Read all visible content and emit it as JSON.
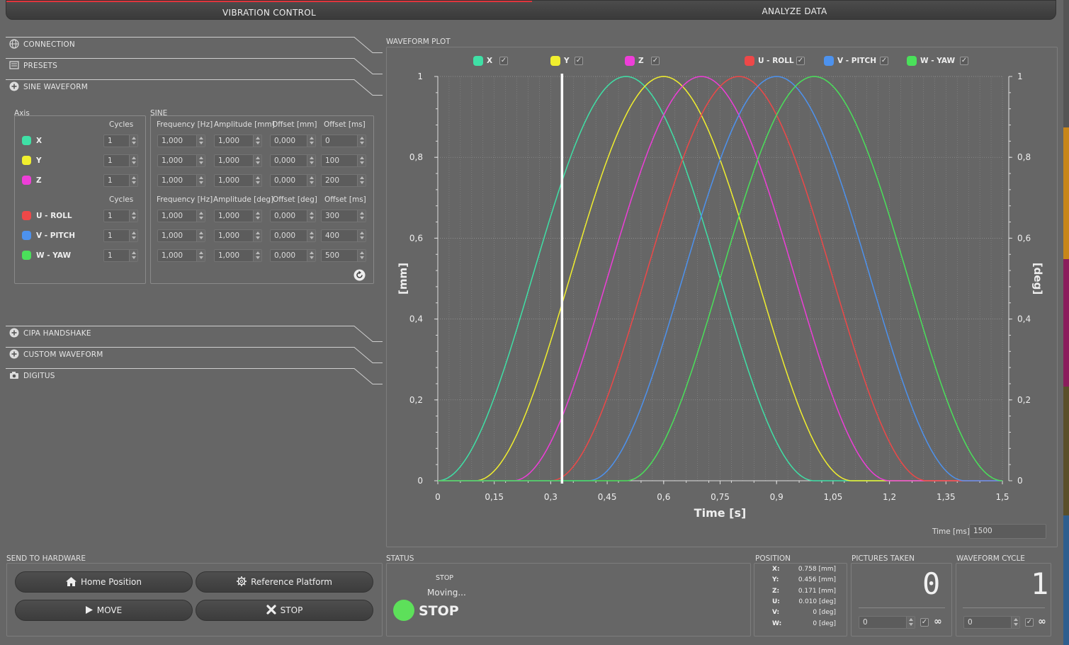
{
  "tabs": {
    "vibration": "VIBRATION CONTROL",
    "analyze": "ANALYZE DATA"
  },
  "sections": {
    "connection": "CONNECTION",
    "presets": "PRESETS",
    "sine_waveform": "SINE WAVEFORM",
    "cipa": "CIPA HANDSHAKE",
    "custom": "CUSTOM WAVEFORM",
    "digitus": "DIGITUS"
  },
  "axis_group": {
    "title": "Axis",
    "cycles_header": "Cycles"
  },
  "sine_group": {
    "title": "SINE",
    "lin_headers": [
      "Frequency [Hz]",
      "Amplitude [mm]",
      "Offset [mm]",
      "Offset [ms]"
    ],
    "rot_headers": [
      "Frequency [Hz]",
      "Amplitude [deg]",
      "Offset [deg]",
      "Offset [ms]"
    ]
  },
  "axes": [
    {
      "name": "X",
      "color": "#3fe0a6",
      "cycles": "1",
      "freq": "1,000",
      "amp": "1,000",
      "off": "0,000",
      "offms": "0"
    },
    {
      "name": "Y",
      "color": "#f1ef2e",
      "cycles": "1",
      "freq": "1,000",
      "amp": "1,000",
      "off": "0,000",
      "offms": "100"
    },
    {
      "name": "Z",
      "color": "#ee3ed8",
      "cycles": "1",
      "freq": "1,000",
      "amp": "1,000",
      "off": "0,000",
      "offms": "200"
    },
    {
      "name": "U - ROLL",
      "color": "#ee4848",
      "cycles": "1",
      "freq": "1,000",
      "amp": "1,000",
      "off": "0,000",
      "offms": "300"
    },
    {
      "name": "V - PITCH",
      "color": "#4d92ee",
      "cycles": "1",
      "freq": "1,000",
      "amp": "1,000",
      "off": "0,000",
      "offms": "400"
    },
    {
      "name": "W - YAW",
      "color": "#4ae05a",
      "cycles": "1",
      "freq": "1,000",
      "amp": "1,000",
      "off": "0,000",
      "offms": "500"
    }
  ],
  "plot": {
    "title": "WAVEFORM PLOT",
    "time_label": "Time [ms]",
    "time_value": "1500",
    "check": "✓"
  },
  "chart_data": {
    "type": "line",
    "xlabel": "Time [s]",
    "ylabel": "[mm]",
    "y2label": "[deg]",
    "xlim": [
      0,
      1.5
    ],
    "ylim": [
      0,
      1
    ],
    "x_ticks": [
      "0",
      "0,15",
      "0,3",
      "0,45",
      "0,6",
      "0,75",
      "0,9",
      "1,05",
      "1,2",
      "1,35",
      "1,5"
    ],
    "y_ticks": [
      "0",
      "0,2",
      "0,4",
      "0,6",
      "0,8",
      "1"
    ],
    "grid": true,
    "legend_position": "top",
    "cursor_x": 0.33,
    "series": [
      {
        "name": "X",
        "color": "#3fe0a6",
        "x": [
          0,
          0.1,
          0.2,
          0.3,
          0.4,
          0.5,
          0.6,
          0.7,
          0.8,
          0.9,
          1.0,
          1.1,
          1.2,
          1.3,
          1.4,
          1.5
        ],
        "values": [
          0,
          0.095,
          0.345,
          0.655,
          0.905,
          1,
          0.905,
          0.655,
          0.345,
          0.095,
          0,
          0,
          0,
          0,
          0,
          0
        ]
      },
      {
        "name": "Y",
        "color": "#f1ef2e",
        "x": [
          0,
          0.1,
          0.2,
          0.3,
          0.4,
          0.5,
          0.6,
          0.7,
          0.8,
          0.9,
          1.0,
          1.1,
          1.2,
          1.3,
          1.4,
          1.5
        ],
        "values": [
          0,
          0,
          0.095,
          0.345,
          0.655,
          0.905,
          1,
          0.905,
          0.655,
          0.345,
          0.095,
          0,
          0,
          0,
          0,
          0
        ]
      },
      {
        "name": "Z",
        "color": "#ee3ed8",
        "x": [
          0,
          0.1,
          0.2,
          0.3,
          0.4,
          0.5,
          0.6,
          0.7,
          0.8,
          0.9,
          1.0,
          1.1,
          1.2,
          1.3,
          1.4,
          1.5
        ],
        "values": [
          0,
          0,
          0,
          0.095,
          0.345,
          0.655,
          0.905,
          1,
          0.905,
          0.655,
          0.345,
          0.095,
          0,
          0,
          0,
          0
        ]
      },
      {
        "name": "U - ROLL",
        "color": "#ee4848",
        "x": [
          0,
          0.1,
          0.2,
          0.3,
          0.4,
          0.5,
          0.6,
          0.7,
          0.8,
          0.9,
          1.0,
          1.1,
          1.2,
          1.3,
          1.4,
          1.5
        ],
        "values": [
          0,
          0,
          0,
          0,
          0.095,
          0.345,
          0.655,
          0.905,
          1,
          0.905,
          0.655,
          0.345,
          0.095,
          0,
          0,
          0
        ]
      },
      {
        "name": "V - PITCH",
        "color": "#4d92ee",
        "x": [
          0,
          0.1,
          0.2,
          0.3,
          0.4,
          0.5,
          0.6,
          0.7,
          0.8,
          0.9,
          1.0,
          1.1,
          1.2,
          1.3,
          1.4,
          1.5
        ],
        "values": [
          0,
          0,
          0,
          0,
          0,
          0.095,
          0.345,
          0.655,
          0.905,
          1,
          0.905,
          0.655,
          0.345,
          0.095,
          0,
          0
        ]
      },
      {
        "name": "W - YAW",
        "color": "#4ae05a",
        "x": [
          0,
          0.1,
          0.2,
          0.3,
          0.4,
          0.5,
          0.6,
          0.7,
          0.8,
          0.9,
          1.0,
          1.1,
          1.2,
          1.3,
          1.4,
          1.5
        ],
        "values": [
          0,
          0,
          0,
          0,
          0,
          0,
          0.095,
          0.345,
          0.655,
          0.905,
          1,
          0.905,
          0.655,
          0.345,
          0.095,
          0
        ]
      }
    ]
  },
  "hardware": {
    "title": "SEND TO HARDWARE",
    "home": "Home Position",
    "reference": "Reference Platform",
    "move": "MOVE",
    "stop": "STOP"
  },
  "status": {
    "title": "STATUS",
    "small": "STOP",
    "moving": "Moving...",
    "big": "STOP",
    "led_color": "#5de05a"
  },
  "position": {
    "title": "POSITION",
    "rows": [
      {
        "k": "X:",
        "v": "0.758 [mm]"
      },
      {
        "k": "Y:",
        "v": "0.456 [mm]"
      },
      {
        "k": "Z:",
        "v": "0.171 [mm]"
      },
      {
        "k": "U:",
        "v": "0.010 [deg]"
      },
      {
        "k": "V:",
        "v": "0 [deg]"
      },
      {
        "k": "W:",
        "v": "0 [deg]"
      }
    ]
  },
  "pictures": {
    "title": "PICTURES TAKEN",
    "count": "0",
    "input": "0",
    "infinity": "∞"
  },
  "cycle": {
    "title": "WAVEFORM CYCLE",
    "count": "1",
    "input": "0",
    "infinity": "∞"
  },
  "side_strip_colors": [
    "#555",
    "#c88a1a",
    "#8a1a5a",
    "#3a6a8a"
  ]
}
